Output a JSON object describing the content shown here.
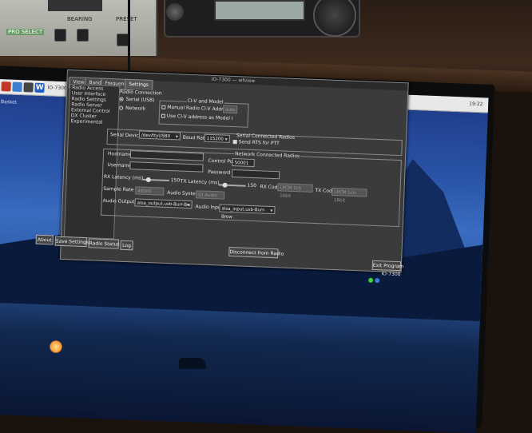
{
  "preamp": {
    "label_left": "PRO SELECT",
    "label_mid": "BEARING",
    "label_right": "PRESET"
  },
  "taskbar": {
    "window_title": "IO-7300 — wfview",
    "clock": "19:22"
  },
  "desktop": {
    "icon_label": "Basket"
  },
  "window": {
    "title": "IO-7300 — wfview"
  },
  "tabs": [
    "View",
    "Band",
    "Frequency",
    "Settings"
  ],
  "active_tab": "Settings",
  "settings_nav": [
    "Radio Access",
    "User Interface",
    "Radio Settings",
    "Radio Server",
    "External Control",
    "DX Cluster",
    "Experimental"
  ],
  "radio_connection": {
    "heading": "Radio Connection",
    "serial_label": "Serial (USB)",
    "network_label": "Network",
    "selected": "serial"
  },
  "civ": {
    "heading": "CI-V and Model",
    "manual_label": "Manual Radio CI-V Address:",
    "manual_checked": false,
    "use_civ_label": "Use CI-V address as Model I",
    "use_civ_checked": false,
    "address_value": "auto"
  },
  "serial": {
    "device_label": "Serial Device:",
    "device_value": "/dev/ttyUSB0",
    "baud_label": "Baud Rate",
    "baud_value": "115200",
    "group_label": "Serial Connected Radios",
    "rts_label": "Send RTS for PTT",
    "rts_checked": true
  },
  "network": {
    "group_label": "Network Connected Radios",
    "hostname_label": "Hostname",
    "hostname_value": "",
    "control_port_label": "Control Port",
    "control_port_value": "50001",
    "username_label": "Username",
    "username_value": "",
    "password_label": "Password",
    "password_value": "",
    "rx_latency_label": "RX Latency (ms)",
    "rx_latency_value": "150",
    "tx_latency_label": "TX Latency (ms)",
    "tx_latency_value": "150",
    "rx_codec_label": "RX Codec",
    "rx_codec_value": "LPCM 1ch 16bit",
    "tx_codec_label": "TX Codec",
    "tx_codec_value": "LPCM 1ch 16bit",
    "sample_rate_label": "Sample Rate",
    "sample_rate_value": "48000",
    "audio_system_label": "Audio System",
    "audio_system_value": "Qt Audio"
  },
  "audio": {
    "output_label": "Audio Output",
    "output_value": "alsa_output.usb-Burr-Brc",
    "input_label": "Audio Input",
    "input_value": "alsa_input.usb-Burr-Brow"
  },
  "buttons": {
    "about": "About",
    "save": "Save Settings",
    "radio_status": "Radio Status",
    "log": "Log",
    "disconnect": "Disconnect from Radio",
    "exit": "Exit Program"
  },
  "status": {
    "radio_name": "IO-7300",
    "dot_colors": [
      "#3ecf3e",
      "#3a7bd5"
    ]
  },
  "colors": {
    "window_bg": "#3b3b3b",
    "desktop_top": "#1d3a86",
    "lamp": "#ff9a2e"
  }
}
